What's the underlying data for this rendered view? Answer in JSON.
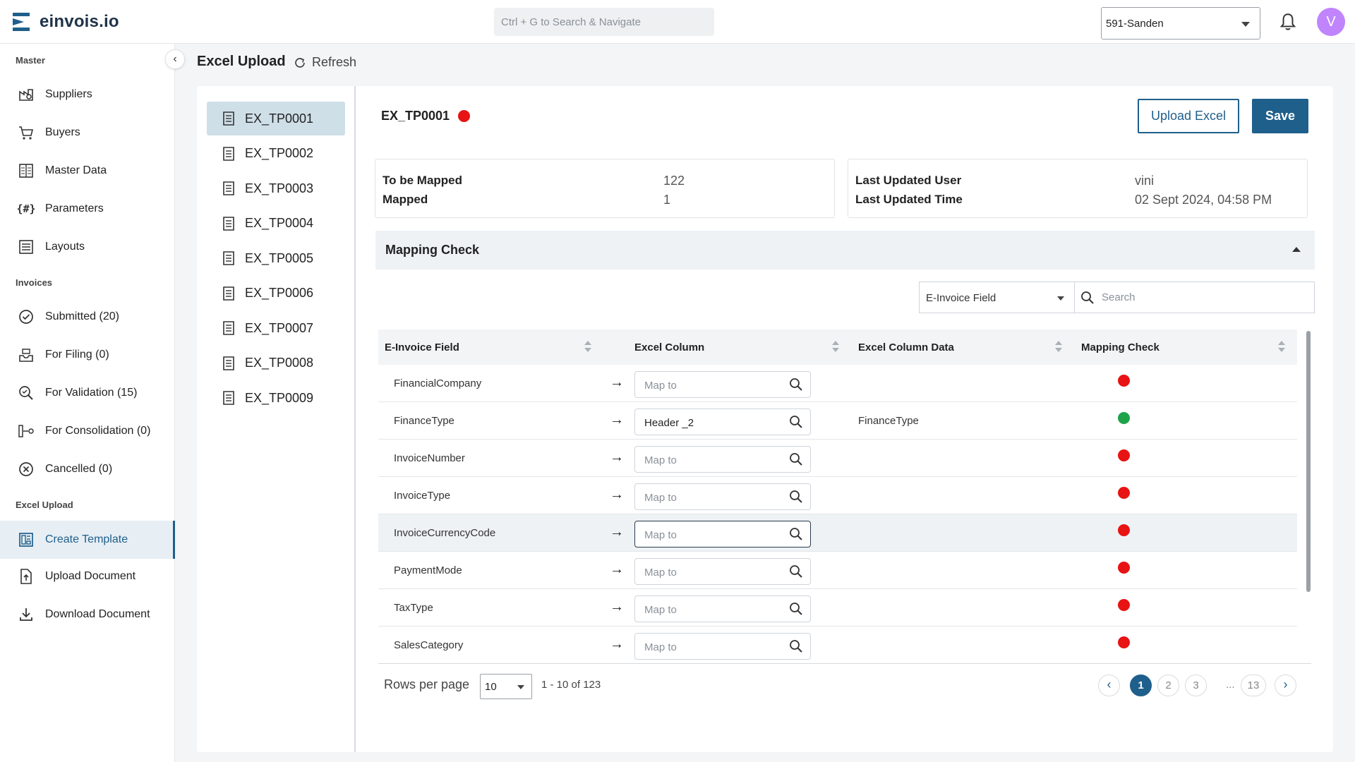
{
  "app": {
    "name": "einvois.io",
    "search_placeholder": "Ctrl + G to Search & Navigate",
    "company": "591-Sanden",
    "avatar_initial": "V"
  },
  "sidebar": {
    "sections": [
      {
        "label": "Master"
      },
      {
        "label": "Invoices"
      },
      {
        "label": "Excel Upload"
      }
    ],
    "items": [
      {
        "label": "Suppliers",
        "icon": "suppliers-icon"
      },
      {
        "label": "Buyers",
        "icon": "cart-icon"
      },
      {
        "label": "Master Data",
        "icon": "master-data-icon"
      },
      {
        "label": "Parameters",
        "icon": "parameters-icon"
      },
      {
        "label": "Layouts",
        "icon": "layouts-icon"
      },
      {
        "label": "Submitted (20)",
        "icon": "check-circle-icon"
      },
      {
        "label": "For Filing (0)",
        "icon": "inbox-icon"
      },
      {
        "label": "For Validation (15)",
        "icon": "search-check-icon"
      },
      {
        "label": "For Consolidation (0)",
        "icon": "consolidate-icon"
      },
      {
        "label": "Cancelled (0)",
        "icon": "cancel-circle-icon"
      },
      {
        "label": "Create Template",
        "icon": "template-icon",
        "active": true
      },
      {
        "label": "Upload Document",
        "icon": "upload-doc-icon"
      },
      {
        "label": "Download Document",
        "icon": "download-icon"
      }
    ]
  },
  "header": {
    "title": "Excel Upload",
    "refresh_label": "Refresh"
  },
  "templates": [
    "EX_TP0001",
    "EX_TP0002",
    "EX_TP0003",
    "EX_TP0004",
    "EX_TP0005",
    "EX_TP0006",
    "EX_TP0007",
    "EX_TP0008",
    "EX_TP0009"
  ],
  "detail": {
    "template_name": "EX_TP0001",
    "status_color": "#e81313",
    "upload_label": "Upload Excel",
    "save_label": "Save",
    "to_be_mapped_label": "To be Mapped",
    "to_be_mapped_value": "122",
    "mapped_label": "Mapped",
    "mapped_value": "1",
    "last_user_label": "Last Updated User",
    "last_user_value": "vini",
    "last_time_label": "Last Updated Time",
    "last_time_value": "02 Sept 2024, 04:58 PM"
  },
  "mapping": {
    "title": "Mapping Check",
    "filter_value": "E-Invoice Field",
    "search_placeholder": "Search",
    "columns": [
      "E-Invoice Field",
      "Excel Column",
      "Excel Column Data",
      "Mapping Check"
    ],
    "rows": [
      {
        "field": "FinancialCompany",
        "excel_column": "",
        "placeholder": "Map to",
        "column_data": "",
        "status": "red"
      },
      {
        "field": "FinanceType",
        "excel_column": "Header _2",
        "placeholder": "Map to",
        "column_data": "FinanceType",
        "status": "green"
      },
      {
        "field": "InvoiceNumber",
        "excel_column": "",
        "placeholder": "Map to",
        "column_data": "",
        "status": "red"
      },
      {
        "field": "InvoiceType",
        "excel_column": "",
        "placeholder": "Map to",
        "column_data": "",
        "status": "red"
      },
      {
        "field": "InvoiceCurrencyCode",
        "excel_column": "",
        "placeholder": "Map to",
        "column_data": "",
        "status": "red"
      },
      {
        "field": "PaymentMode",
        "excel_column": "",
        "placeholder": "Map to",
        "column_data": "",
        "status": "red"
      },
      {
        "field": "TaxType",
        "excel_column": "",
        "placeholder": "Map to",
        "column_data": "",
        "status": "red"
      },
      {
        "field": "SalesCategory",
        "excel_column": "",
        "placeholder": "Map to",
        "column_data": "",
        "status": "red"
      }
    ],
    "status_colors": {
      "red": "#e81313",
      "green": "#1fa34a"
    }
  },
  "pagination": {
    "rows_per_page_label": "Rows per page",
    "rows_per_page": "10",
    "range": "1 - 10 of 123",
    "pages": [
      "1",
      "2",
      "3"
    ],
    "ellipsis": "...",
    "last_page": "13",
    "current": "1"
  }
}
